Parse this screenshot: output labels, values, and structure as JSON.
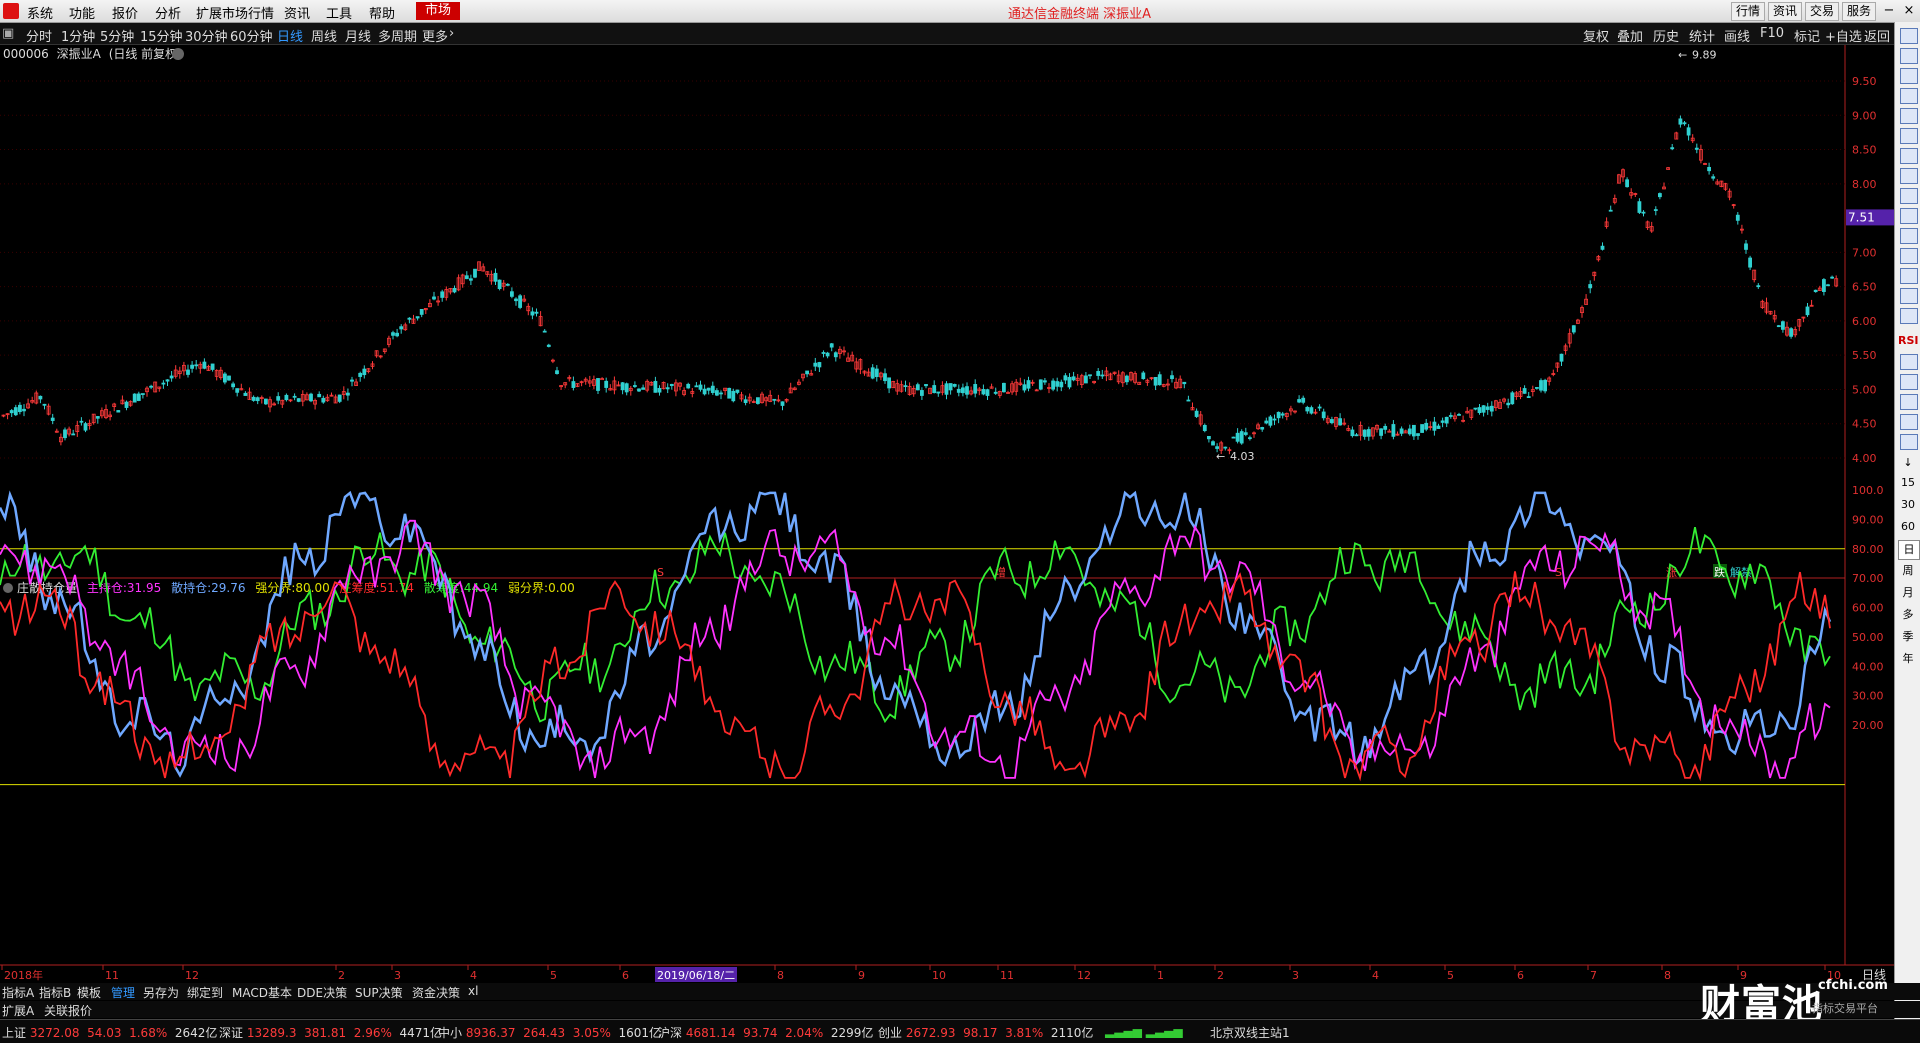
{
  "menubar": {
    "items": [
      "系统",
      "功能",
      "报价",
      "分析",
      "扩展市场行情",
      "资讯",
      "工具",
      "帮助"
    ],
    "market": "市场",
    "title": "通达信金融终端  深振业A",
    "right_buttons": [
      "行情",
      "资讯",
      "交易",
      "服务"
    ]
  },
  "periodbar": {
    "periods": [
      "分时",
      "1分钟",
      "5分钟",
      "15分钟",
      "30分钟",
      "60分钟",
      "日线",
      "周线",
      "月线",
      "多周期",
      "更多"
    ],
    "active": "日线",
    "right_items": [
      "复权",
      "叠加",
      "历史",
      "统计",
      "画线",
      "F10",
      "标记",
      "+自选",
      "返回"
    ]
  },
  "stock": {
    "code": "000006",
    "name": "深振业A",
    "mode": "(日线 前复权)"
  },
  "price_chart": {
    "y_ticks": [
      "9.50",
      "9.00",
      "8.50",
      "8.00",
      "7.00",
      "6.50",
      "6.00",
      "5.50",
      "5.00",
      "4.50",
      "4.00"
    ],
    "y_tick_values": [
      9.5,
      9.0,
      8.5,
      8.0,
      7.0,
      6.5,
      6.0,
      5.5,
      5.0,
      4.5,
      4.0
    ],
    "current_price": "7.51",
    "current_price_value": 7.51,
    "max_label": "9.89",
    "max_value": 9.89,
    "min_label": "4.03",
    "min_value": 4.03,
    "events": [
      "S",
      "增",
      "S",
      "涨",
      "跌",
      "解禁"
    ],
    "colors": {
      "up": "#ff3a3a",
      "down": "#30d0d0",
      "axis": "#b02020",
      "grid": "#3a0000"
    }
  },
  "indicator": {
    "name": "庄散持仓量",
    "items": [
      {
        "label": "主持仓:",
        "value": "31.95",
        "color": "#ff33ff"
      },
      {
        "label": "散持仓:",
        "value": "29.76",
        "color": "#6fa8ff"
      },
      {
        "label": "强分界:",
        "value": "80.00",
        "color": "#e0e000"
      },
      {
        "label": "庄筹度:",
        "value": "51.74",
        "color": "#ff2a2a"
      },
      {
        "label": "散筹度:",
        "value": "44.94",
        "color": "#33ee33"
      },
      {
        "label": "弱分界:",
        "value": "0.00",
        "color": "#e0e000"
      }
    ],
    "y_ticks": [
      "100.0",
      "90.00",
      "80.00",
      "70.00",
      "60.00",
      "50.00",
      "40.00",
      "30.00",
      "20.00"
    ],
    "y_tick_values": [
      100,
      90,
      80,
      70,
      60,
      50,
      40,
      30,
      20
    ]
  },
  "x_axis": {
    "labels": [
      "2018年",
      "11",
      "12",
      "2",
      "3",
      "4",
      "5",
      "6",
      "2019/06/18/二",
      "8",
      "9",
      "10",
      "11",
      "12",
      "1",
      "2",
      "3",
      "4",
      "5",
      "6",
      "7",
      "8",
      "9",
      "10"
    ],
    "cursor_label": "2019/06/18/二",
    "period_label": "日线"
  },
  "bottom_tabs_1": [
    "指标A",
    "指标B",
    "模板",
    "管理",
    "另存为",
    "绑定到",
    "MACD基本",
    "DDE决策",
    "SUP决策",
    "资金决策",
    "xl"
  ],
  "bottom_tabs_1_active": "管理",
  "bottom_tabs_2": [
    "扩展A",
    "关联报价"
  ],
  "sidebar": {
    "labels": [
      "RSI",
      "15",
      "30",
      "60",
      "日",
      "周",
      "月",
      "多",
      "季",
      "年"
    ]
  },
  "status": [
    {
      "name": "上证",
      "price": "3272.08",
      "chg": "54.03",
      "pct": "1.68%",
      "amt": "2642亿"
    },
    {
      "name": "深证",
      "price": "13289.3",
      "chg": "381.81",
      "pct": "2.96%",
      "amt": "4471亿"
    },
    {
      "name": "中小",
      "price": "8936.37",
      "chg": "264.43",
      "pct": "3.05%",
      "amt": "1601亿"
    },
    {
      "name": "沪深",
      "price": "4681.14",
      "chg": "93.74",
      "pct": "2.04%",
      "amt": "2299亿"
    },
    {
      "name": "创业",
      "price": "2672.93",
      "chg": "98.17",
      "pct": "3.81%",
      "amt": "2110亿"
    }
  ],
  "server": "北京双线主站1",
  "watermark": {
    "main": "财富池",
    "site": "cfchi.com",
    "sub": "指标交易平台"
  }
}
